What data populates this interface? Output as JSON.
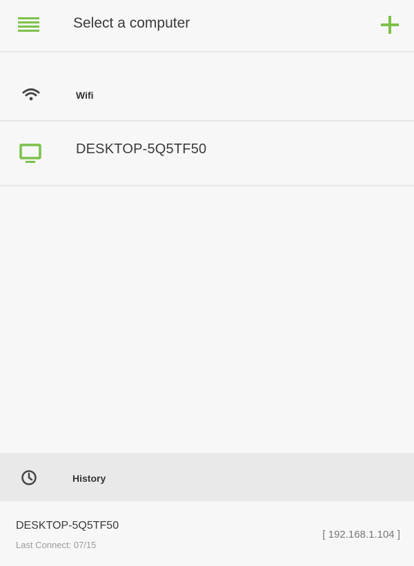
{
  "header": {
    "title": "Select a computer",
    "menu_icon": "menu-icon",
    "add_icon": "plus-icon"
  },
  "colors": {
    "accent": "#7cc14a",
    "text": "#3a3a3a",
    "background": "#f7f7f7",
    "history_header_bg": "#e9e9e9"
  },
  "wifi_section": {
    "icon": "wifi-icon",
    "label": "Wifi"
  },
  "computers": [
    {
      "icon": "monitor-icon",
      "name": "DESKTOP-5Q5TF50"
    }
  ],
  "history": {
    "icon": "clock-icon",
    "label": "History",
    "items": [
      {
        "name": "DESKTOP-5Q5TF50",
        "last_connect_label": "Last Connect:",
        "last_connect_date": "07/15",
        "ip": "[ 192.168.1.104 ]"
      }
    ]
  }
}
